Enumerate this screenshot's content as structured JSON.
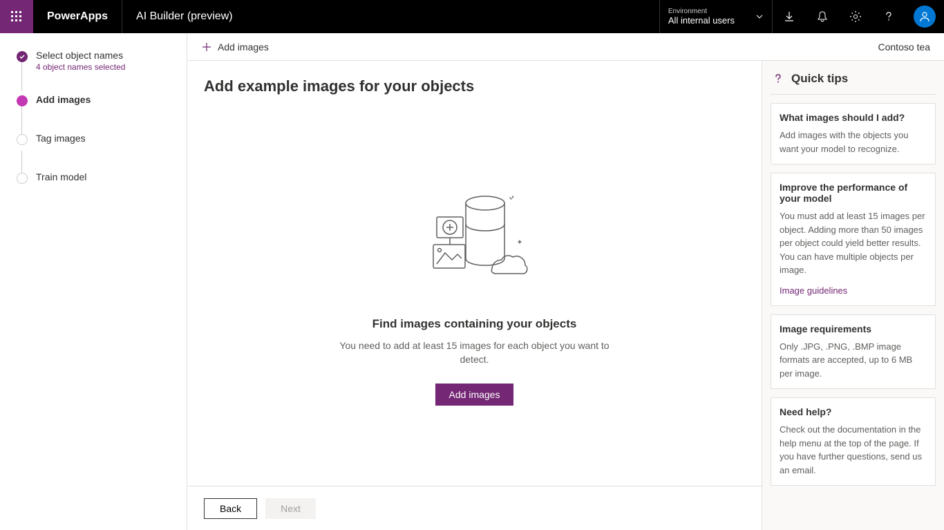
{
  "header": {
    "app_name": "PowerApps",
    "page_title": "AI Builder (preview)",
    "env_label": "Environment",
    "env_value": "All internal users"
  },
  "steps": {
    "items": [
      {
        "title": "Select object names",
        "subtitle": "4 object names selected"
      },
      {
        "title": "Add images"
      },
      {
        "title": "Tag images"
      },
      {
        "title": "Train model"
      }
    ]
  },
  "toolbar": {
    "add_images": "Add images",
    "model_name": "Contoso tea"
  },
  "main": {
    "heading": "Add example images for your objects",
    "empty_title": "Find images containing your objects",
    "empty_desc": "You need to add at least 15 images for each object you want to detect.",
    "add_button": "Add images"
  },
  "tips": {
    "header": "Quick tips",
    "cards": [
      {
        "title": "What images should I add?",
        "body": "Add images with the objects you want your model to recognize."
      },
      {
        "title": "Improve the performance of your model",
        "body": "You must add at least 15 images per object. Adding more than 50 images per object could yield better results. You can have multiple objects per image.",
        "link": "Image guidelines"
      },
      {
        "title": "Image requirements",
        "body": "Only .JPG, .PNG, .BMP image formats are accepted, up to 6 MB per image."
      },
      {
        "title": "Need help?",
        "body": "Check out the documentation in the help menu at the top of the page. If you have further questions, send us an email."
      }
    ]
  },
  "footer": {
    "back": "Back",
    "next": "Next"
  }
}
